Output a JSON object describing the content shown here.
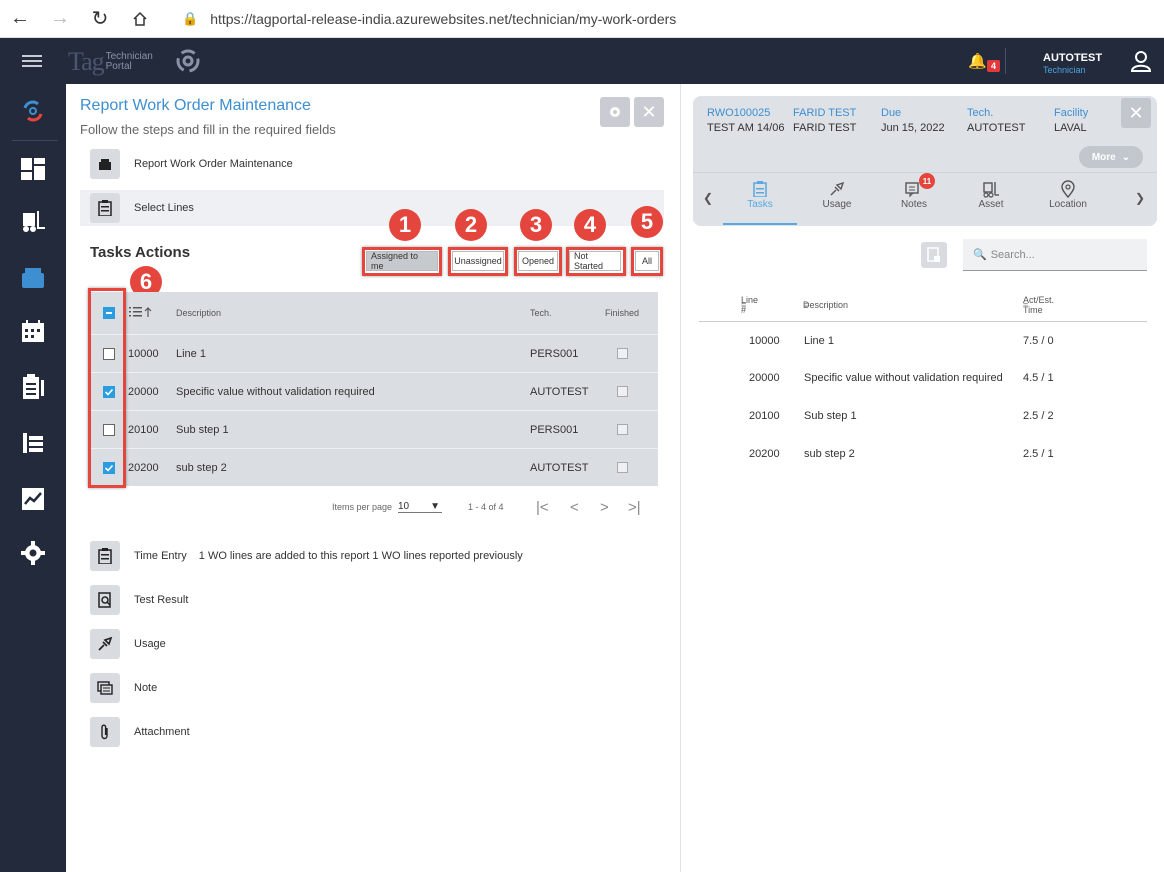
{
  "browser": {
    "url": "https://tagportal-release-india.azurewebsites.net/technician/my-work-orders"
  },
  "topbar": {
    "logo_main": "Tag",
    "logo_line1": "Technician",
    "logo_line2": "Portal",
    "notification_count": "4",
    "user_name": "AUTOTEST",
    "user_role": "Technician"
  },
  "left": {
    "title": "Report Work Order Maintenance",
    "subtitle": "Follow the steps and fill in the required fields",
    "steps": [
      {
        "label": "Report Work Order Maintenance"
      },
      {
        "label": "Select Lines"
      }
    ],
    "tasks_actions": "Tasks Actions",
    "filters": [
      {
        "label": "Assigned to me",
        "marker": "1"
      },
      {
        "label": "Unassigned",
        "marker": "2"
      },
      {
        "label": "Opened",
        "marker": "3"
      },
      {
        "label": "Not Started",
        "marker": "4"
      },
      {
        "label": "All",
        "marker": "5"
      }
    ],
    "select_marker": "6",
    "table": {
      "col_description": "Description",
      "col_tech": "Tech.",
      "col_finished": "Finished",
      "rows": [
        {
          "line": "10000",
          "description": "Line 1",
          "tech": "PERS001",
          "checked": false
        },
        {
          "line": "20000",
          "description": "Specific value without validation required",
          "tech": "AUTOTEST",
          "checked": true
        },
        {
          "line": "20100",
          "description": "Sub step 1",
          "tech": "PERS001",
          "checked": false
        },
        {
          "line": "20200",
          "description": "sub step 2",
          "tech": "AUTOTEST",
          "checked": true
        }
      ]
    },
    "pager": {
      "items_per_page_label": "Items per page",
      "items_per_page": "10",
      "range": "1 - 4 of 4"
    },
    "bottom_steps": [
      {
        "label": "Time Entry",
        "extra": "1 WO lines are added to this report 1 WO lines reported previously",
        "icon": "clipboard-icon"
      },
      {
        "label": "Test Result",
        "extra": "",
        "icon": "test-result-icon"
      },
      {
        "label": "Usage",
        "extra": "",
        "icon": "spark-plug-icon"
      },
      {
        "label": "Note",
        "extra": "",
        "icon": "note-icon"
      },
      {
        "label": "Attachment",
        "extra": "",
        "icon": "paperclip-icon"
      }
    ]
  },
  "right": {
    "card": {
      "wo_number": "RWO100025",
      "wo_desc": "TEST AM 14/06",
      "requester_label": "FARID TEST",
      "requester_value": "FARID TEST",
      "due_label": "Due",
      "due_value": "Jun 15, 2022",
      "tech_label": "Tech.",
      "tech_value": "AUTOTEST",
      "facility_label": "Facility",
      "facility_value": "LAVAL",
      "more": "More"
    },
    "tabs": [
      {
        "label": "Tasks",
        "active": true
      },
      {
        "label": "Usage",
        "active": false
      },
      {
        "label": "Notes",
        "active": false,
        "badge": "11"
      },
      {
        "label": "Asset",
        "active": false
      },
      {
        "label": "Location",
        "active": false
      }
    ],
    "search_placeholder": "Search...",
    "table": {
      "col_line": "Line #",
      "col_description": "Description",
      "col_time": "Act/Est. Time",
      "rows": [
        {
          "line": "10000",
          "description": "Line 1",
          "time": "7.5 / 0"
        },
        {
          "line": "20000",
          "description": "Specific value without validation required",
          "time": "4.5 / 1"
        },
        {
          "line": "20100",
          "description": "Sub step 1",
          "time": "2.5 / 2"
        },
        {
          "line": "20200",
          "description": "sub step 2",
          "time": "2.5 / 1"
        }
      ]
    }
  }
}
